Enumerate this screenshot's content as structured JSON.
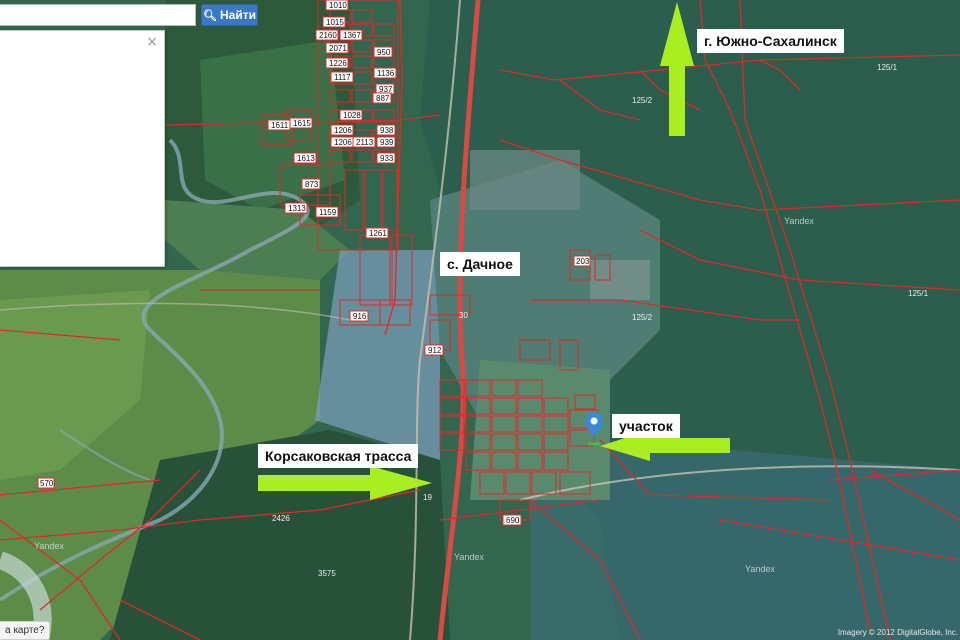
{
  "search": {
    "placeholder": "",
    "value": "",
    "button_label": "Найти"
  },
  "info_panel": {
    "close_symbol": "×"
  },
  "report_link": {
    "label": "а карте?"
  },
  "labels": {
    "city": "г. Южно-Сахалинск",
    "village": "с. Дачное",
    "highway": "Корсаковская трасса",
    "plot": "участок"
  },
  "map": {
    "watermark": "Yandex",
    "copyright": "Imagery © 2012 DigitalGlobe, Inc.",
    "parcel_numbers": [
      "1010",
      "1015",
      "2160",
      "1367",
      "950",
      "2071",
      "1226",
      "1136",
      "1117",
      "937",
      "887",
      "1611",
      "1615",
      "1028",
      "1206",
      "938",
      "1206",
      "2113",
      "939",
      "933",
      "1613",
      "873",
      "1313",
      "1159",
      "1261",
      "916",
      "912",
      "125/1",
      "125/2",
      "125/2",
      "125/1",
      "203",
      "30",
      "19",
      "690",
      "2426",
      "3575",
      "570"
    ]
  },
  "colors": {
    "boundary": "#e02828",
    "arrow": "#aaee22",
    "marker": "#3a88d6",
    "button": "#3a78c3",
    "road": "#d84a44"
  }
}
